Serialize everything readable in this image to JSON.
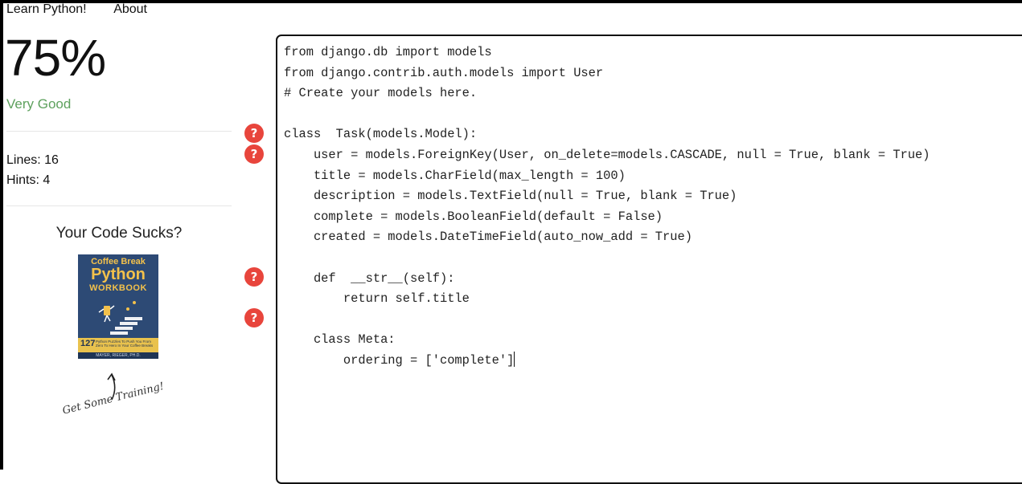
{
  "nav": {
    "links": [
      "Learn Python!",
      "About"
    ]
  },
  "score": {
    "value": "75%",
    "rating": "Very Good",
    "rating_color": "#5ea15e"
  },
  "stats": {
    "lines": "Lines: 16",
    "hints": "Hints: 4"
  },
  "promo": {
    "title": "Your Code Sucks?",
    "book": {
      "line1": "Coffee Break",
      "line2": "Python",
      "line3": "WORKBOOK",
      "number": "127",
      "subtitle": "Python Puzzles To Push You From Zero To Hero In Your Coffee Breaks",
      "author": "MAYER, RIEGER, PH.D."
    },
    "call_to_action": "Get Some Training!"
  },
  "hints": {
    "icon": "question-icon",
    "glyph": "?",
    "color": "#e8453c"
  },
  "editor": {
    "code": "from django.db import models\nfrom django.contrib.auth.models import User\n# Create your models here.\n\nclass  Task(models.Model):\n    user = models.ForeignKey(User, on_delete=models.CASCADE, null = True, blank = True)\n    title = models.CharField(max_length = 100)\n    description = models.TextField(null = True, blank = True)\n    complete = models.BooleanField(default = False)\n    created = models.DateTimeField(auto_now_add = True)\n\n    def  __str__(self):\n        return self.title\n\n    class Meta:\n        ordering = ['complete']"
  }
}
